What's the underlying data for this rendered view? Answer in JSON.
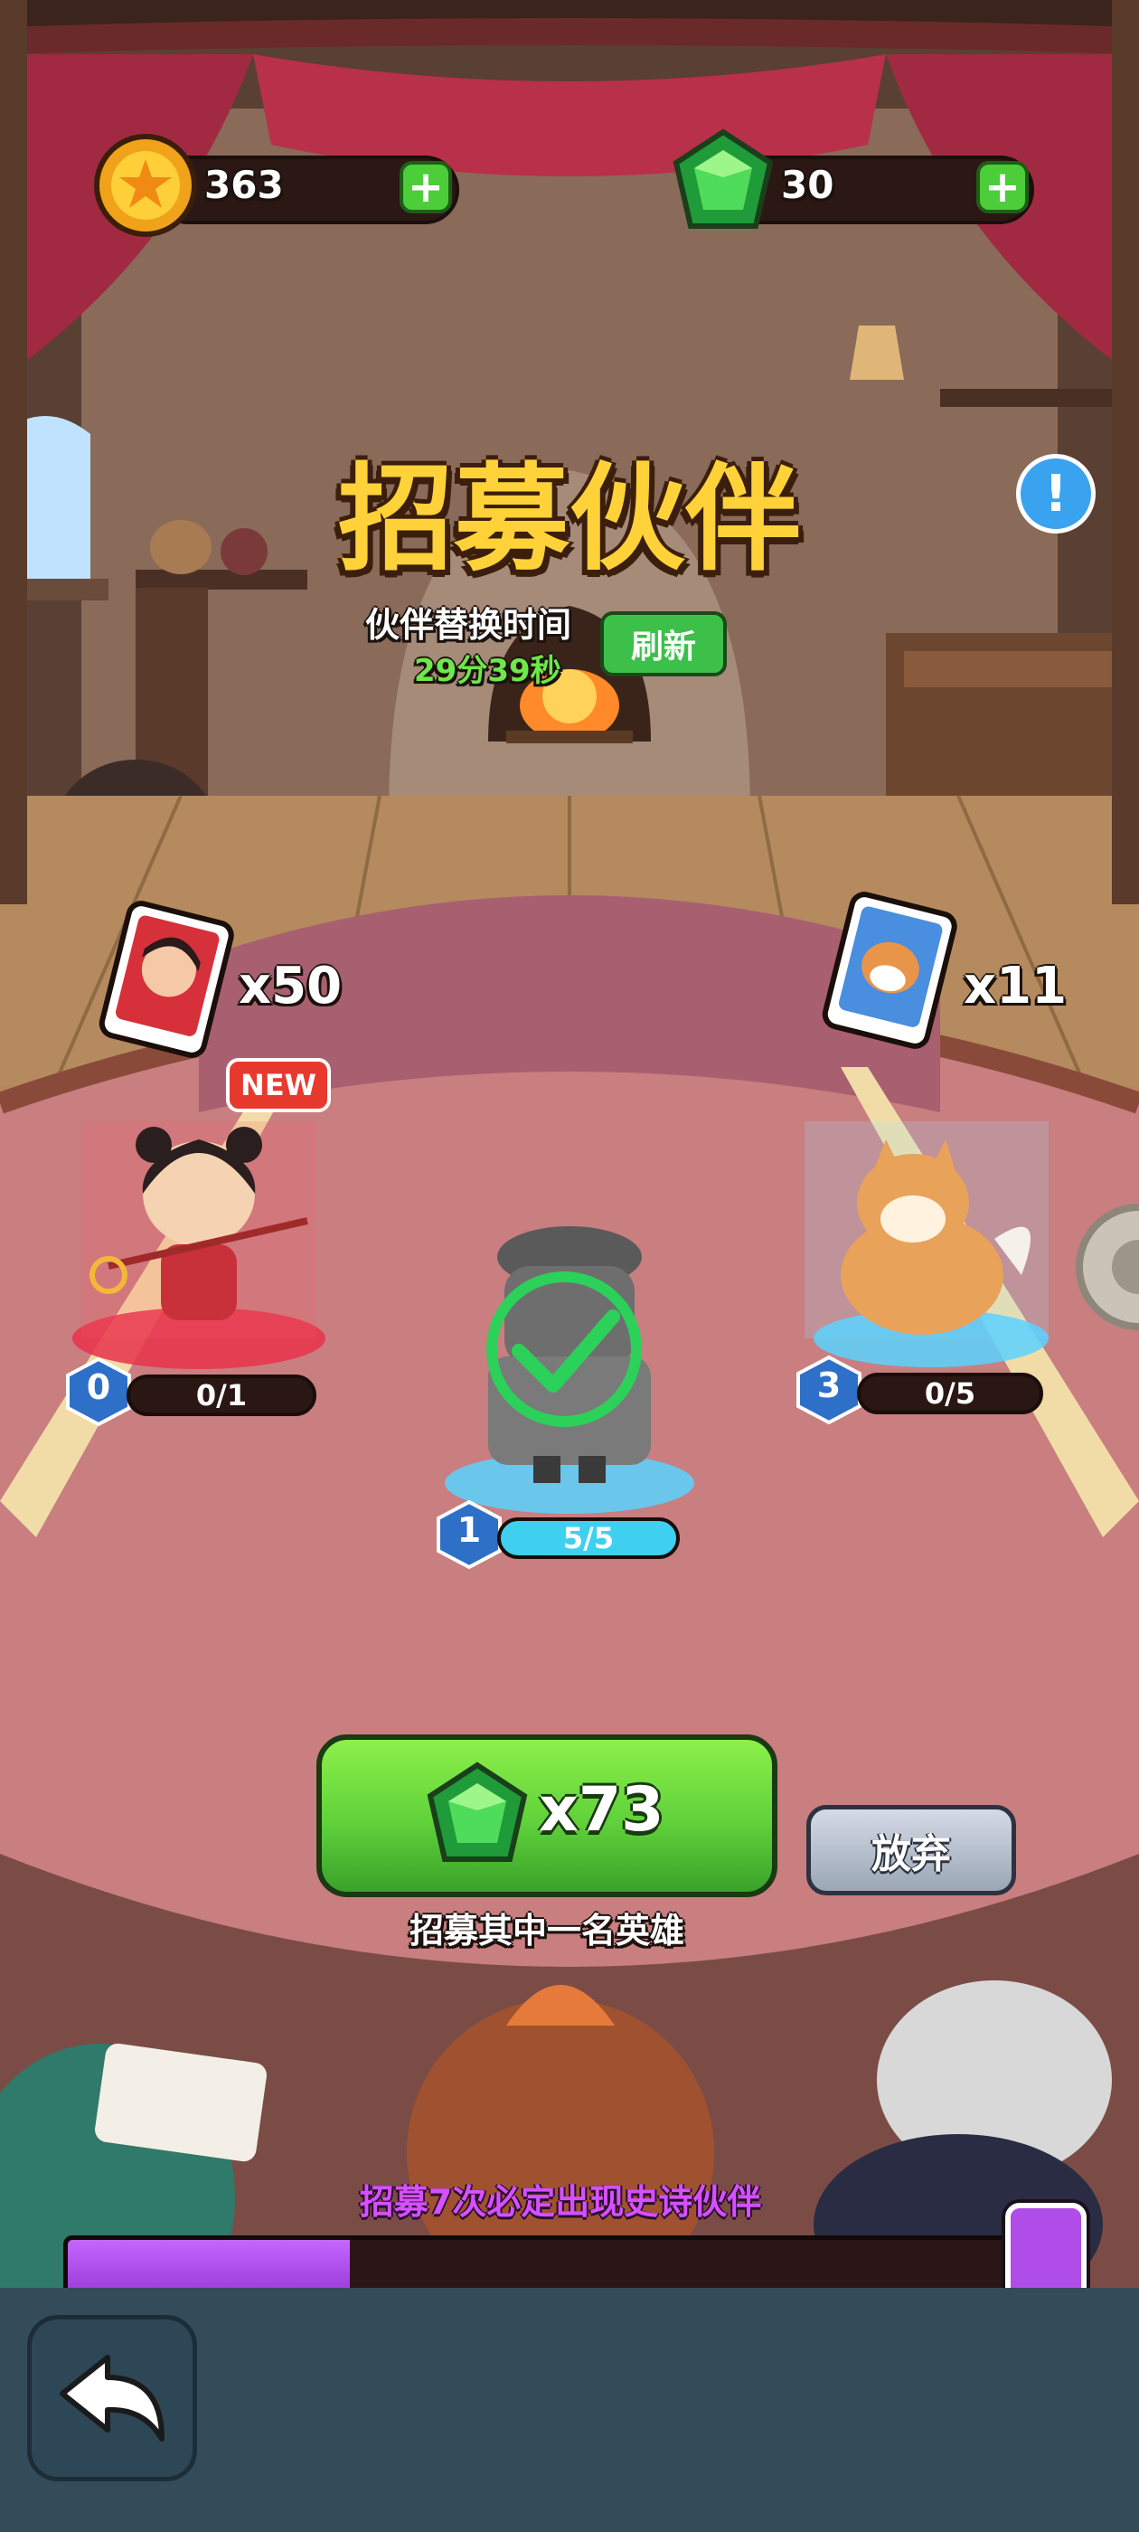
{
  "currency": {
    "coins": "363",
    "gems": "30"
  },
  "title": "招募伙伴",
  "refresh": {
    "label": "伙伴替换时间",
    "timer": "29分39秒",
    "button": "刷新"
  },
  "cards": {
    "left_count": "x50",
    "right_count": "x11"
  },
  "heroes": [
    {
      "badge": "NEW",
      "level": "0",
      "progress_text": "0/1",
      "progress": 0.0
    },
    {
      "level": "1",
      "progress_text": "5/5",
      "progress": 1.0,
      "selected": true
    },
    {
      "level": "3",
      "progress_text": "0/5",
      "progress": 0.0
    }
  ],
  "recruit": {
    "cost": "x73",
    "caption": "招募其中一名英雄",
    "abandon": "放弃"
  },
  "pity": {
    "text": "招募7次必定出现史诗伙伴",
    "progress": 0.3
  },
  "colors": {
    "accent_green": "#5fd13a",
    "title_yellow": "#ffd23a",
    "pity_purple": "#b04de8",
    "level_blue": "#38a8e6",
    "bottom_bar": "#344c5a"
  },
  "icons": [
    "coin-icon",
    "gem-icon",
    "plus-icon",
    "info-icon",
    "settings-gear-icon",
    "checkmark-icon",
    "back-arrow-icon"
  ]
}
